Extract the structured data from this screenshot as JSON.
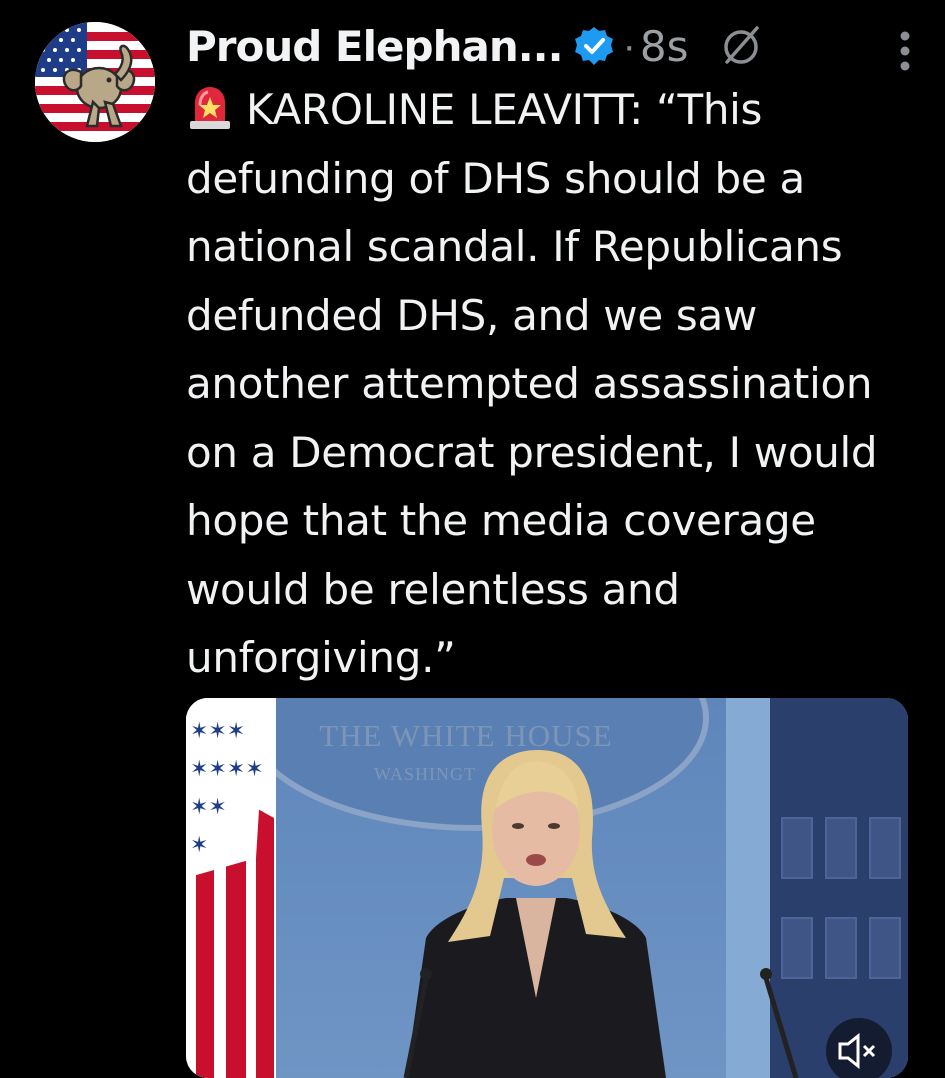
{
  "post": {
    "display_name": "Proud Elephan...",
    "separator": "·",
    "timestamp": "8s",
    "text": "KAROLINE LEAVITT: “This defunding of DHS should be a national scandal. If Republicans defunded DHS, and we saw another attempted assassination on a Democrat president, I would hope that the media coverage would be relentless and unforgiving.”",
    "leading_emoji": "siren-icon"
  },
  "media": {
    "seal_title": "THE WHITE HOUSE",
    "seal_subtitle": "WASHINGT"
  },
  "icons": {
    "verified": "verified-badge-icon",
    "grok": "grok-icon",
    "more": "more-vertical-icon",
    "mute": "mute-icon"
  },
  "colors": {
    "background": "#000000",
    "text": "#e7e9ea",
    "muted": "#9ba0a5",
    "verified": "#1d9bf0"
  }
}
